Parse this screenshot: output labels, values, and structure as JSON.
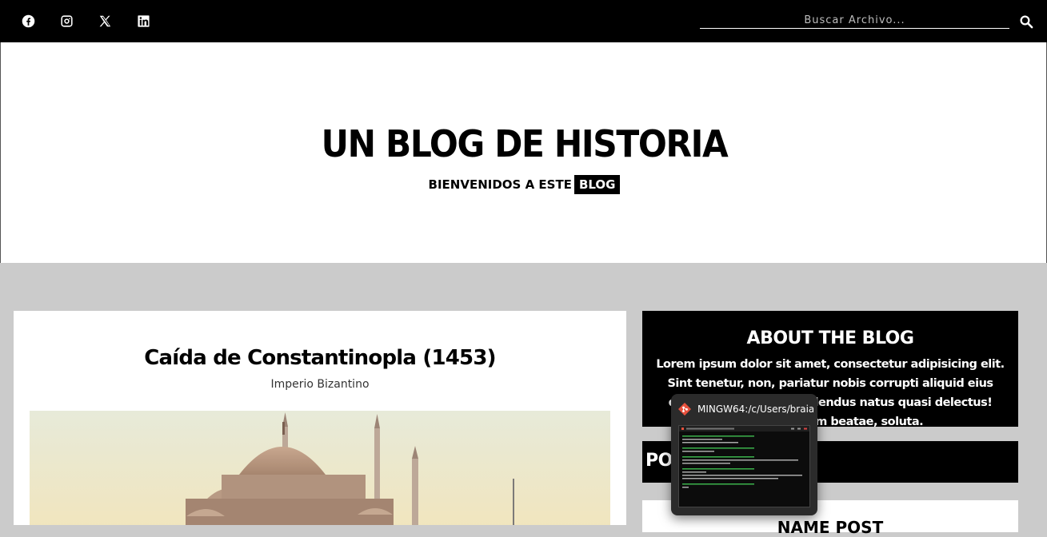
{
  "topbar": {
    "social": [
      {
        "name": "facebook-icon"
      },
      {
        "name": "instagram-icon"
      },
      {
        "name": "x-icon"
      },
      {
        "name": "linkedin-icon"
      }
    ],
    "search": {
      "placeholder": "Buscar Archivo..."
    },
    "search_icon": "search-icon"
  },
  "header": {
    "title": "UN BLOG DE HISTORIA",
    "tagline": "BIENVENIDOS A ESTE",
    "tagline_badge": "BLOG"
  },
  "post": {
    "title": "Caída de Constantinopla (1453)",
    "subtitle": "Imperio Bizantino"
  },
  "sidebar": {
    "about_title": "ABOUT THE BLOG",
    "about_text": "Lorem ipsum dolor sit amet, consectetur adipisicing elit. Sint tenetur, non, pariatur nobis corrupti aliquid eius quis architecto ad repellendus natus quasi delectus! Suscipit totam beatae, soluta.",
    "popular_title": "POPULAR POSTS",
    "popular_card_title": "NAME POST"
  },
  "taskbar_preview": {
    "title": "MINGW64:/c/Users/braia..."
  },
  "colors": {
    "topbar": "#000000",
    "background": "#cbcbcb",
    "card": "#ffffff",
    "sidebar_block": "#000000"
  }
}
